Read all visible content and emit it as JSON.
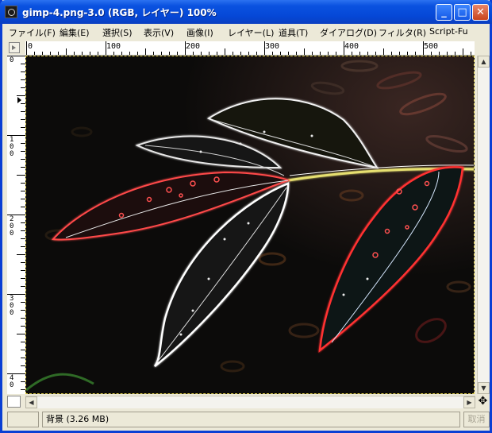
{
  "window": {
    "title": "gimp-4.png-3.0 (RGB, レイヤー) 100%"
  },
  "menu": [
    "ファイル(F)",
    "編集(E)",
    "選択(S)",
    "表示(V)",
    "画像(I)",
    "レイヤー(L)",
    "道具(T)",
    "ダイアログ(D)",
    "フィルタ(R)",
    "Script-Fu"
  ],
  "ruler": {
    "horizontal": [
      "0",
      "100",
      "200",
      "300",
      "400",
      "500"
    ],
    "vertical": [
      [
        "0"
      ],
      [
        "1",
        "0",
        "0"
      ],
      [
        "2",
        "0",
        "0"
      ],
      [
        "3",
        "0",
        "0"
      ],
      [
        "4",
        "0"
      ]
    ]
  },
  "status": {
    "text": "背景 (3.26 MB)",
    "cancel": "取消"
  },
  "colors": {
    "title_bar": "#0a52e0",
    "selection_border": "#e2d04a",
    "canvas_bg": "#0c0b0a"
  },
  "icons": [
    "app-icon",
    "minimize-icon",
    "maximize-icon",
    "close-icon",
    "navigate-icon",
    "quick-mask-icon"
  ]
}
